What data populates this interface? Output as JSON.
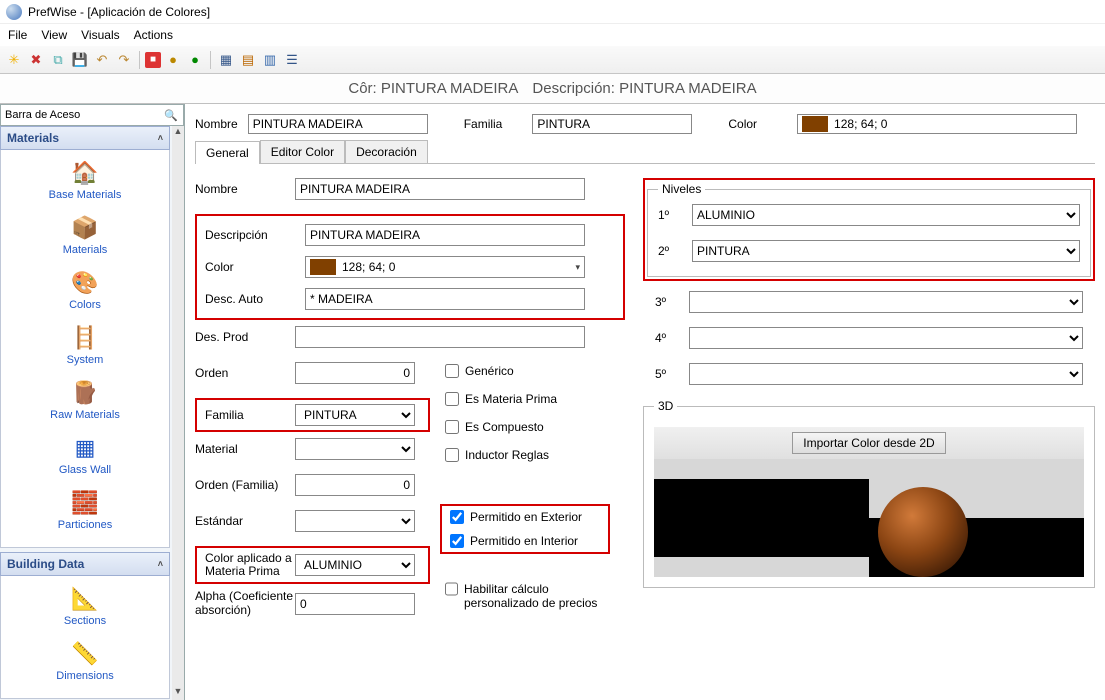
{
  "window": {
    "title": "PrefWise - [Aplicación de Colores]"
  },
  "menu": {
    "file": "File",
    "view": "View",
    "visuals": "Visuals",
    "actions": "Actions"
  },
  "header": {
    "cor_label": "Côr:",
    "cor_value": "PINTURA MADEIRA",
    "desc_label": "Descripción:",
    "desc_value": "PINTURA MADEIRA"
  },
  "nav_search_placeholder": "Barra de Aceso",
  "panels": {
    "materials": {
      "title": "Materials",
      "items": [
        {
          "label": "Base Materials"
        },
        {
          "label": "Materials"
        },
        {
          "label": "Colors"
        },
        {
          "label": "System"
        },
        {
          "label": "Raw Materials"
        },
        {
          "label": "Glass Wall"
        },
        {
          "label": "Particiones"
        }
      ]
    },
    "building": {
      "title": "Building Data",
      "items": [
        {
          "label": "Sections"
        },
        {
          "label": "Dimensions"
        }
      ]
    }
  },
  "top": {
    "nombre_lbl": "Nombre",
    "nombre_val": "PINTURA MADEIRA",
    "familia_lbl": "Familia",
    "familia_val": "PINTURA",
    "color_lbl": "Color",
    "color_val": "128; 64; 0"
  },
  "tabs": {
    "general": "General",
    "editor": "Editor Color",
    "decoracion": "Decoración"
  },
  "form": {
    "nombre_lbl": "Nombre",
    "nombre_val": "PINTURA MADEIRA",
    "descripcion_lbl": "Descripción",
    "descripcion_val": "PINTURA MADEIRA",
    "color_lbl": "Color",
    "color_val": "128; 64; 0",
    "descauto_lbl": "Desc. Auto",
    "descauto_val": "* MADEIRA",
    "desprod_lbl": "Des. Prod",
    "desprod_val": "",
    "orden_lbl": "Orden",
    "orden_val": "0",
    "familia_lbl": "Familia",
    "familia_val": "PINTURA",
    "material_lbl": "Material",
    "material_val": "",
    "ordenfam_lbl": "Orden (Familia)",
    "ordenfam_val": "0",
    "estandar_lbl": "Estándar",
    "estandar_val": "",
    "coloraplicado_lbl": "Color aplicado a Materia Prima",
    "coloraplicado_val": "ALUMINIO",
    "alpha_lbl": "Alpha (Coeficiente absorción)",
    "alpha_val": "0"
  },
  "checks": {
    "generico": "Genérico",
    "materiaprima": "Es Materia Prima",
    "compuesto": "Es Compuesto",
    "inductor": "Inductor Reglas",
    "exterior": "Permitido en Exterior",
    "interior": "Permitido en Interior",
    "habilitar": "Habilitar cálculo personalizado de precios"
  },
  "niveles": {
    "legend": "Niveles",
    "rows": [
      {
        "lbl": "1º",
        "val": "ALUMINIO"
      },
      {
        "lbl": "2º",
        "val": "PINTURA"
      },
      {
        "lbl": "3º",
        "val": ""
      },
      {
        "lbl": "4º",
        "val": ""
      },
      {
        "lbl": "5º",
        "val": ""
      }
    ]
  },
  "threeD": {
    "legend": "3D",
    "import_btn": "Importar Color desde 2D"
  }
}
